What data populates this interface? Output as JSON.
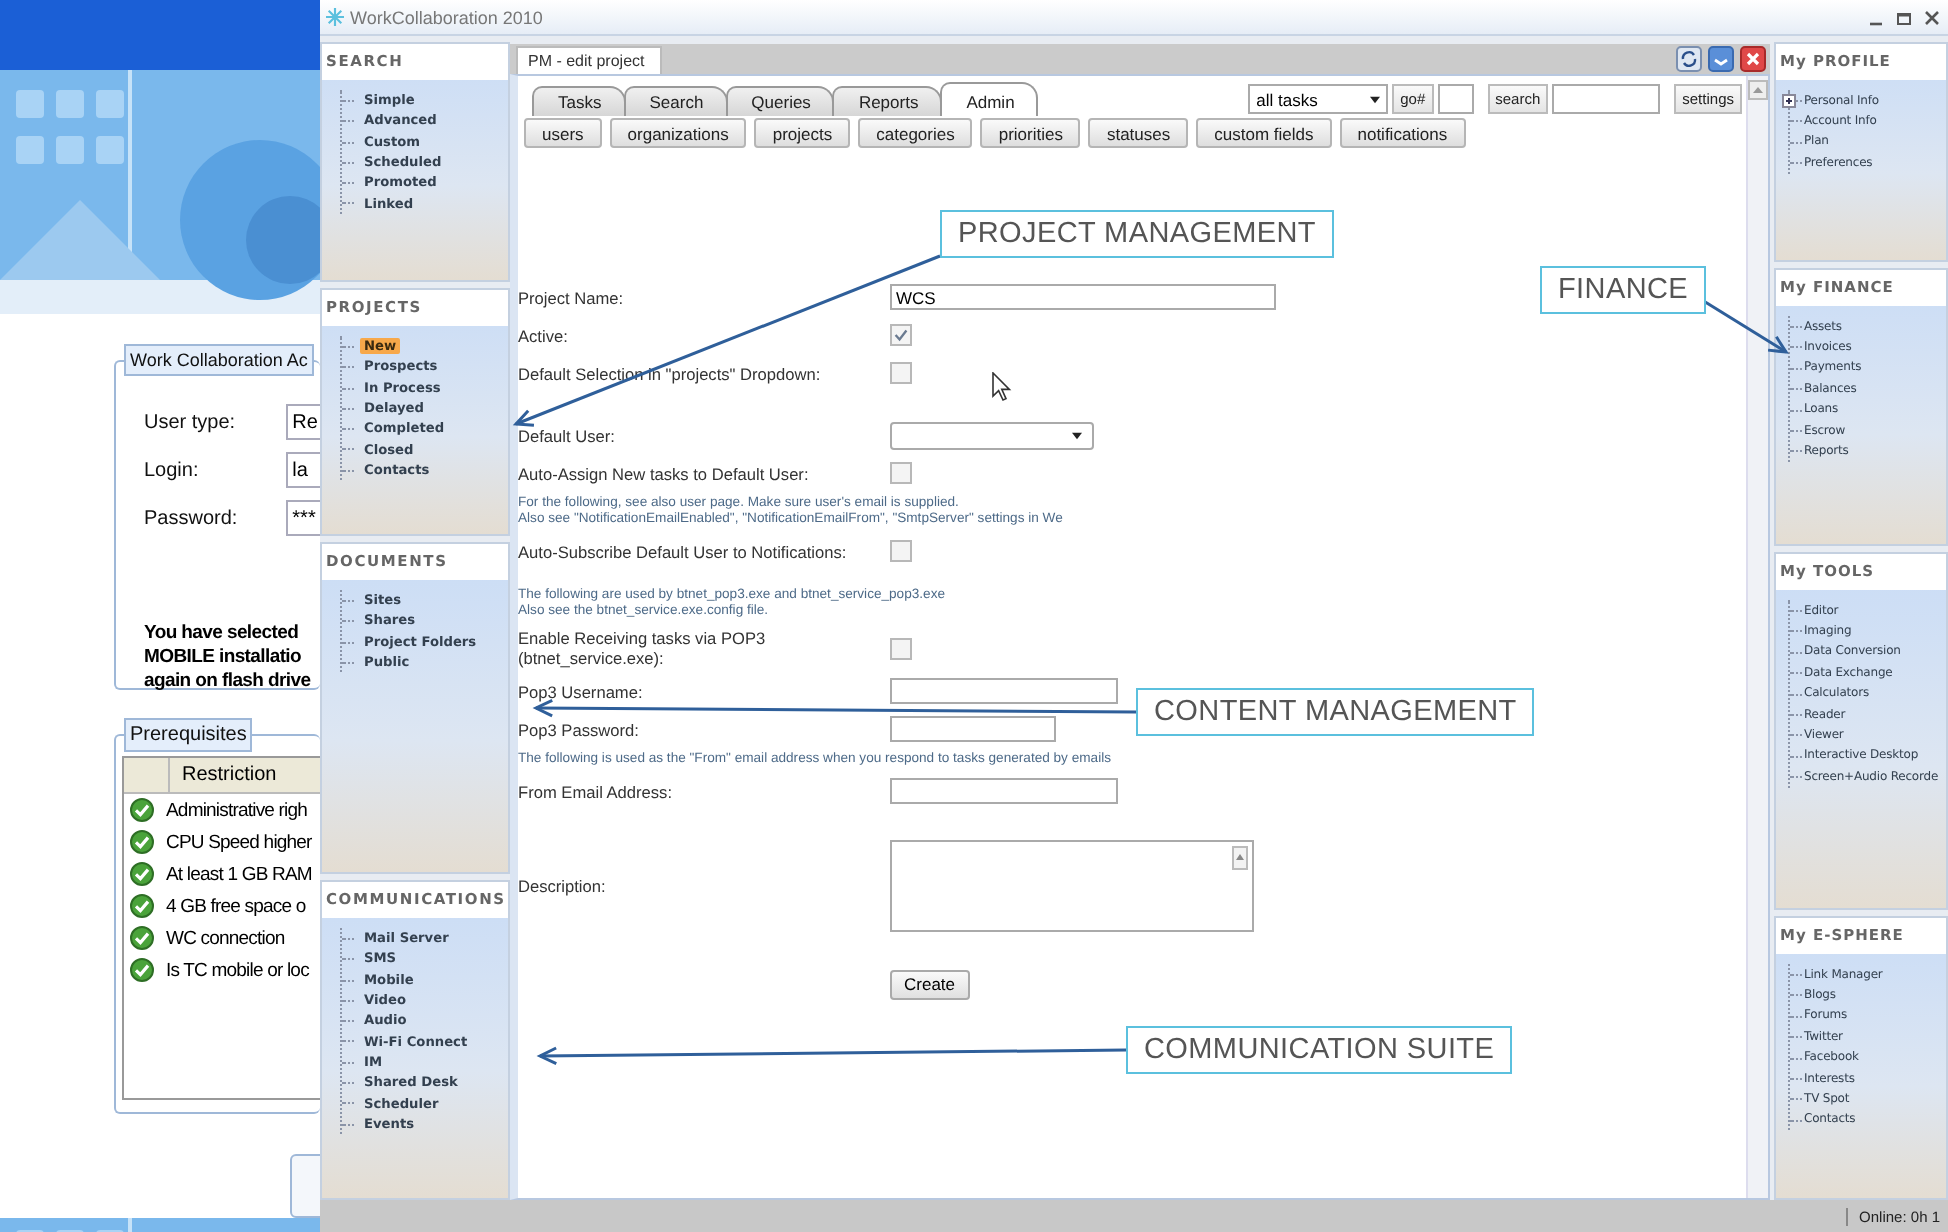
{
  "background_window": {
    "group_title": "Work Collaboration Ac",
    "fields": [
      {
        "label": "User type:",
        "value": "Re"
      },
      {
        "label": "Login:",
        "value": "la"
      },
      {
        "label": "Password:",
        "value": "***"
      }
    ],
    "notice": [
      "You have selected",
      "MOBILE installatio",
      "again on flash drive"
    ],
    "prerequisites": {
      "title": "Prerequisites",
      "column": "Restriction",
      "rows": [
        "Administrative righ",
        "CPU Speed higher",
        "At least 1 GB RAM",
        "4 GB free space o",
        "WC connection",
        "Is TC mobile or loc"
      ]
    }
  },
  "window": {
    "title": "WorkCollaboration 2010"
  },
  "left_sidebar": [
    {
      "title": "SEARCH",
      "items": [
        {
          "label": "Simple",
          "selected": false
        },
        {
          "label": "Advanced",
          "selected": false
        },
        {
          "label": "Custom",
          "selected": false
        },
        {
          "label": "Scheduled",
          "selected": false
        },
        {
          "label": "Promoted",
          "selected": false
        },
        {
          "label": "Linked",
          "selected": false
        }
      ]
    },
    {
      "title": "PROJECTS",
      "items": [
        {
          "label": "New",
          "selected": true
        },
        {
          "label": "Prospects",
          "selected": false
        },
        {
          "label": "In Process",
          "selected": false
        },
        {
          "label": "Delayed",
          "selected": false
        },
        {
          "label": "Completed",
          "selected": false
        },
        {
          "label": "Closed",
          "selected": false
        },
        {
          "label": "Contacts",
          "selected": false
        }
      ]
    },
    {
      "title": "DOCUMENTS",
      "items": [
        {
          "label": "Sites",
          "selected": false
        },
        {
          "label": "Shares",
          "selected": false
        },
        {
          "label": "Project Folders",
          "selected": false
        },
        {
          "label": "Public",
          "selected": false
        }
      ]
    },
    {
      "title": "COMMUNICATIONS",
      "items": [
        {
          "label": "Mail Server",
          "selected": false
        },
        {
          "label": "SMS",
          "selected": false
        },
        {
          "label": "Mobile",
          "selected": false
        },
        {
          "label": "Video",
          "selected": false
        },
        {
          "label": "Audio",
          "selected": false
        },
        {
          "label": "Wi-Fi Connect",
          "selected": false
        },
        {
          "label": "IM",
          "selected": false
        },
        {
          "label": "Shared Desk",
          "selected": false
        },
        {
          "label": "Scheduler",
          "selected": false
        },
        {
          "label": "Events",
          "selected": false
        }
      ]
    }
  ],
  "panel": {
    "title": "PM - edit project"
  },
  "tabs": [
    {
      "label": "Tasks",
      "selected": false
    },
    {
      "label": "Search",
      "selected": false
    },
    {
      "label": "Queries",
      "selected": false
    },
    {
      "label": "Reports",
      "selected": false
    },
    {
      "label": "Admin",
      "selected": true
    }
  ],
  "filter": {
    "select": "all tasks",
    "go_button": "go#",
    "search_button": "search",
    "settings_button": "settings"
  },
  "admin_buttons": [
    "users",
    "organizations",
    "projects",
    "categories",
    "priorities",
    "statuses",
    "custom fields",
    "notifications"
  ],
  "form": {
    "rows": [
      {
        "kind": "text",
        "label": "Project Name:",
        "value": "WCS"
      },
      {
        "kind": "checkbox",
        "label": "Active:",
        "checked": true
      },
      {
        "kind": "checkbox",
        "label": "Default Selection in \"projects\" Dropdown:",
        "checked": false
      },
      {
        "kind": "select",
        "label": "Default User:"
      },
      {
        "kind": "checkbox",
        "label": "Auto-Assign New tasks to Default User:",
        "checked": false
      },
      {
        "kind": "note",
        "lines": [
          "For the following, see also user page. Make sure user's email is supplied.",
          "Also see \"NotificationEmailEnabled\", \"NotificationEmailFrom\", \"SmtpServer\" settings in We"
        ]
      },
      {
        "kind": "checkbox",
        "label": "Auto-Subscribe Default User to Notifications:",
        "checked": false
      },
      {
        "kind": "note",
        "lines": [
          "The following are used by btnet_pop3.exe and btnet_service_pop3.exe",
          "Also see the btnet_service.exe.config file."
        ]
      },
      {
        "kind": "checkbox",
        "label": "Enable Receiving tasks via POP3\n(btnet_service.exe):",
        "checked": false
      },
      {
        "kind": "text",
        "label": "Pop3 Username:"
      },
      {
        "kind": "password",
        "label": "Pop3 Password:"
      },
      {
        "kind": "note",
        "lines": [
          "The following is used as the \"From\" email address when you respond to tasks generated by emails"
        ]
      },
      {
        "kind": "text",
        "label": "From Email Address:"
      },
      {
        "kind": "textarea",
        "label": "Description:"
      }
    ],
    "submit": "Create"
  },
  "right_sidebar": [
    {
      "title": "My PROFILE",
      "items": [
        {
          "label": "Personal Info",
          "kind": "branch"
        },
        {
          "label": "Account Info",
          "kind": "leaf"
        },
        {
          "label": "Plan",
          "kind": "leaf"
        },
        {
          "label": "Preferences",
          "kind": "leaf"
        }
      ]
    },
    {
      "title": "My FINANCE",
      "items": [
        {
          "label": "Assets",
          "kind": "leaf"
        },
        {
          "label": "Invoices",
          "kind": "leaf"
        },
        {
          "label": "Payments",
          "kind": "leaf"
        },
        {
          "label": "Balances",
          "kind": "leaf"
        },
        {
          "label": "Loans",
          "kind": "leaf"
        },
        {
          "label": "Escrow",
          "kind": "leaf"
        },
        {
          "label": "Reports",
          "kind": "leaf"
        }
      ]
    },
    {
      "title": "My TOOLS",
      "items": [
        {
          "label": "Editor",
          "kind": "leaf"
        },
        {
          "label": "Imaging",
          "kind": "leaf"
        },
        {
          "label": "Data Conversion",
          "kind": "leaf"
        },
        {
          "label": "Data Exchange",
          "kind": "leaf"
        },
        {
          "label": "Calculators",
          "kind": "leaf"
        },
        {
          "label": "Reader",
          "kind": "leaf"
        },
        {
          "label": "Viewer",
          "kind": "leaf"
        },
        {
          "label": "Interactive Desktop",
          "kind": "leaf"
        },
        {
          "label": "Screen+Audio Recorde",
          "kind": "leaf"
        }
      ]
    },
    {
      "title": "My E-SPHERE",
      "items": [
        {
          "label": "Link Manager",
          "kind": "leaf"
        },
        {
          "label": "Blogs",
          "kind": "leaf"
        },
        {
          "label": "Forums",
          "kind": "leaf"
        },
        {
          "label": "Twitter",
          "kind": "leaf"
        },
        {
          "label": "Facebook",
          "kind": "leaf"
        },
        {
          "label": "Interests",
          "kind": "leaf"
        },
        {
          "label": "TV Spot",
          "kind": "leaf"
        },
        {
          "label": "Contacts",
          "kind": "leaf"
        }
      ]
    }
  ],
  "status_bar": {
    "text": "Online: 0h 1"
  },
  "annotations": [
    {
      "text": "PROJECT MANAGEMENT"
    },
    {
      "text": "FINANCE"
    },
    {
      "text": "CONTENT MANAGEMENT"
    },
    {
      "text": "COMMUNICATION SUITE"
    }
  ]
}
